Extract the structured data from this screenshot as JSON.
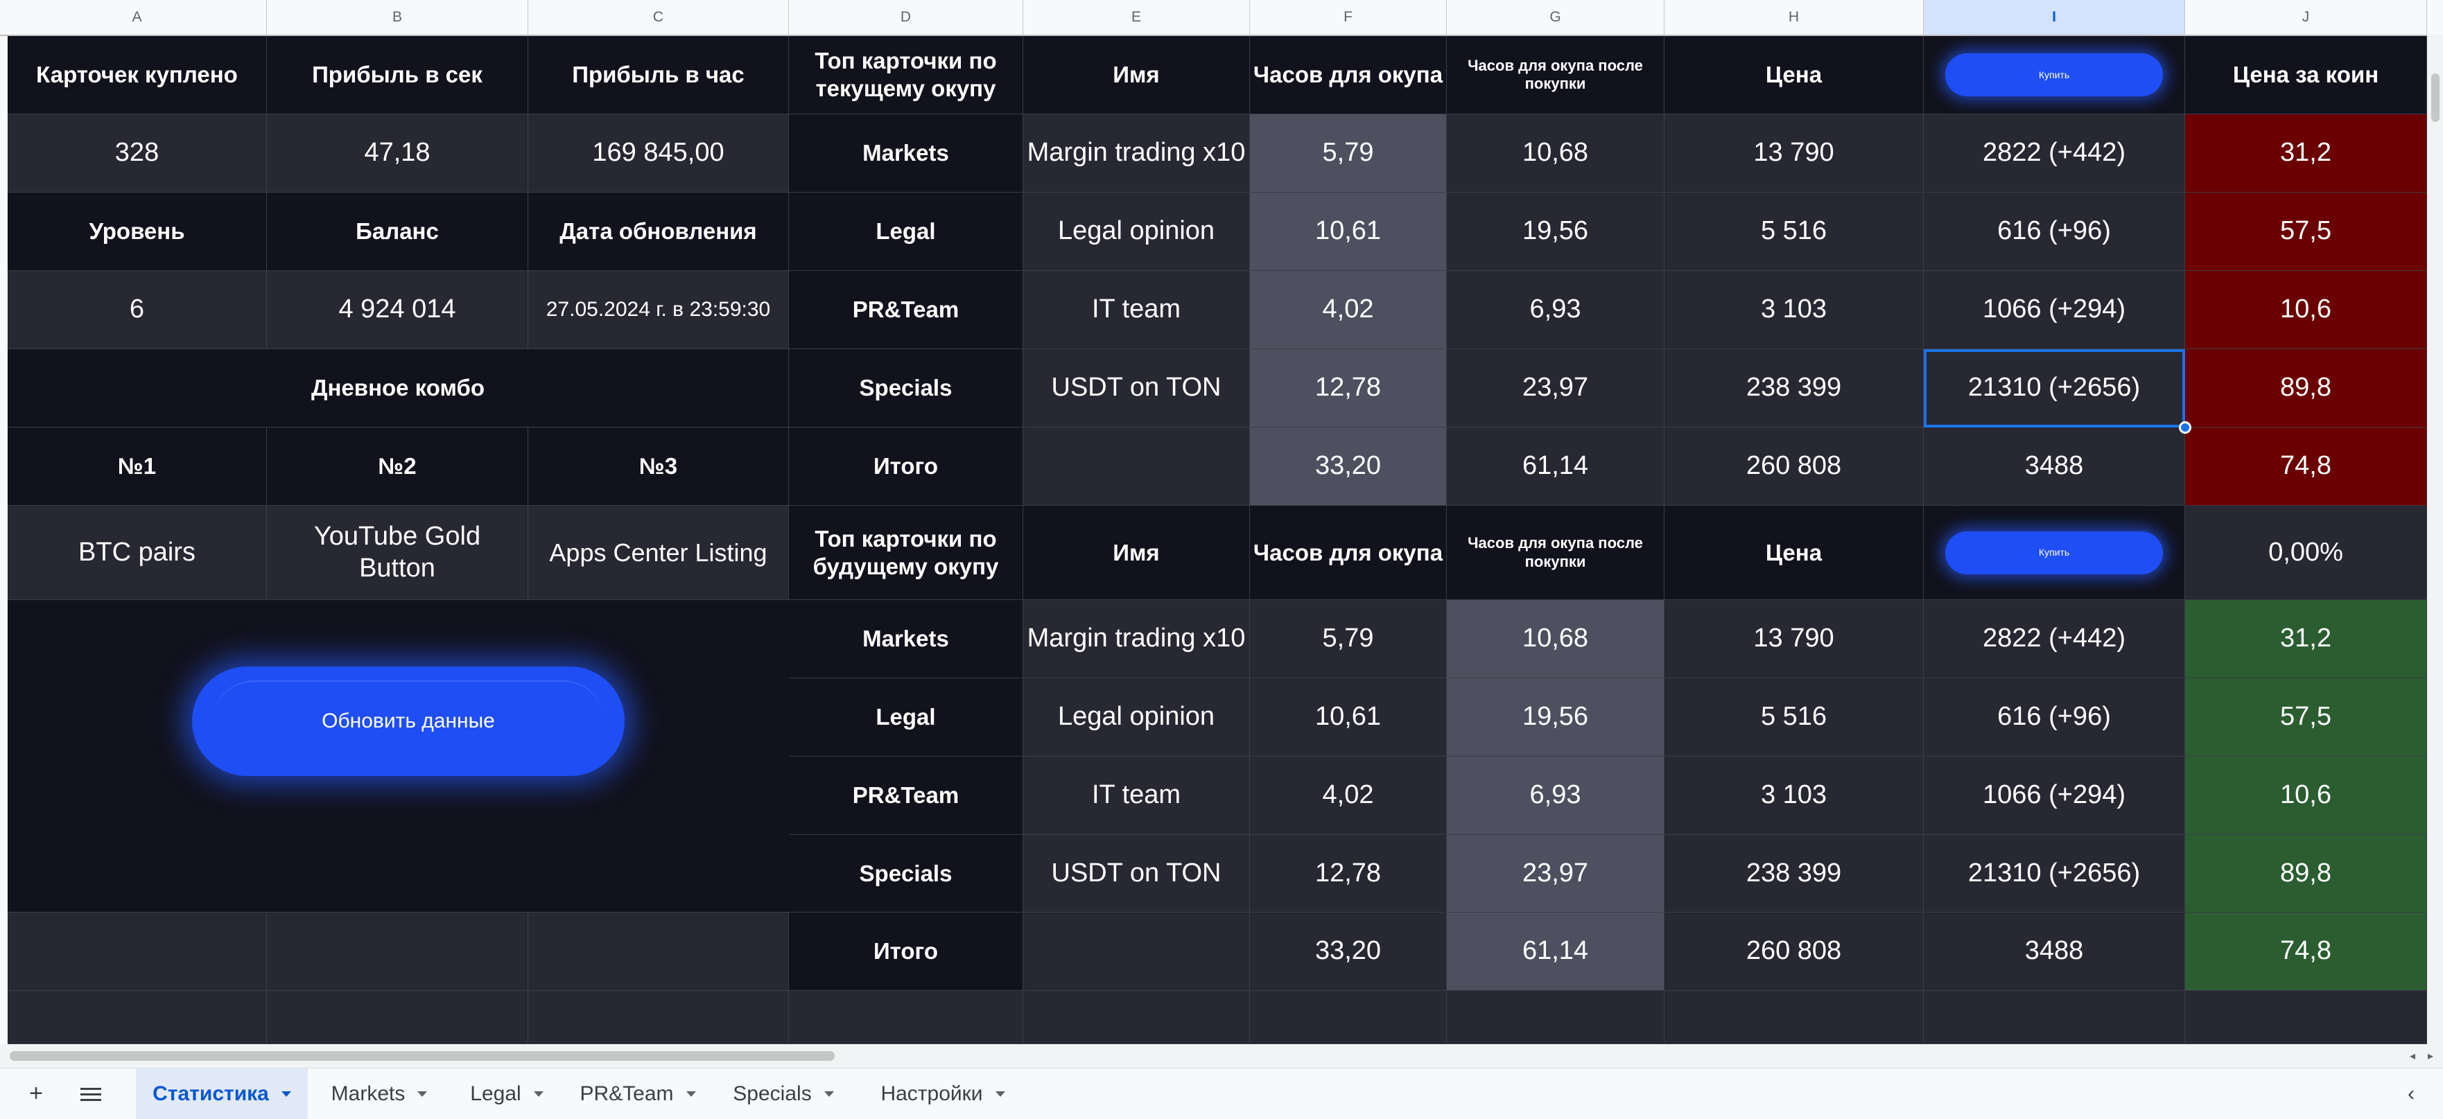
{
  "columns": [
    "A",
    "B",
    "C",
    "D",
    "E",
    "F",
    "G",
    "H",
    "I",
    "J"
  ],
  "stats": {
    "cards_bought_label": "Карточек куплено",
    "profit_sec_label": "Прибыль в сек",
    "profit_hour_label": "Прибыль в час",
    "cards_bought": "328",
    "profit_sec": "47,18",
    "profit_hour": "169 845,00",
    "level_label": "Уровень",
    "balance_label": "Баланс",
    "updated_label": "Дата обновления",
    "level": "6",
    "balance": "4 924 014",
    "updated": "27.05.2024 г. в 23:59:30",
    "combo_title": "Дневное комбо",
    "combo_headers": [
      "№1",
      "№2",
      "№3"
    ],
    "combo_values": [
      "BTC pairs",
      "YouTube Gold Button",
      "Apps Center Listing"
    ],
    "refresh_button": "Обновить данные"
  },
  "current": {
    "headers": {
      "top": "Топ карточки по текущему окупу",
      "name": "Имя",
      "hours": "Часов для окупа",
      "hours_after": "Часов для окупа после покупки",
      "price": "Цена",
      "buy": "Купить",
      "coin_price": "Цена за коин"
    },
    "rows": [
      {
        "cat": "Markets",
        "name": "Margin trading x10",
        "hours": "5,79",
        "hours_after": "10,68",
        "price": "13 790",
        "buy": "2822  (+442)",
        "coin": "31,2"
      },
      {
        "cat": "Legal",
        "name": "Legal opinion",
        "hours": "10,61",
        "hours_after": "19,56",
        "price": "5 516",
        "buy": "616  (+96)",
        "coin": "57,5"
      },
      {
        "cat": "PR&Team",
        "name": "IT team",
        "hours": "4,02",
        "hours_after": "6,93",
        "price": "3 103",
        "buy": "1066  (+294)",
        "coin": "10,6"
      },
      {
        "cat": "Specials",
        "name": "USDT on TON",
        "hours": "12,78",
        "hours_after": "23,97",
        "price": "238 399",
        "buy": "21310  (+2656)",
        "coin": "89,8"
      }
    ],
    "total": {
      "label": "Итого",
      "hours": "33,20",
      "hours_after": "61,14",
      "price": "260 808",
      "buy": "3488",
      "coin": "74,8"
    }
  },
  "future": {
    "headers": {
      "top": "Топ карточки по будущему окупу",
      "name": "Имя",
      "hours": "Часов для окупа",
      "hours_after": "Часов для окупа после покупки",
      "price": "Цена",
      "buy": "Купить",
      "coin_price": "0,00%"
    },
    "rows": [
      {
        "cat": "Markets",
        "name": "Margin trading x10",
        "hours": "5,79",
        "hours_after": "10,68",
        "price": "13 790",
        "buy": "2822  (+442)",
        "coin": "31,2"
      },
      {
        "cat": "Legal",
        "name": "Legal opinion",
        "hours": "10,61",
        "hours_after": "19,56",
        "price": "5 516",
        "buy": "616  (+96)",
        "coin": "57,5"
      },
      {
        "cat": "PR&Team",
        "name": "IT team",
        "hours": "4,02",
        "hours_after": "6,93",
        "price": "3 103",
        "buy": "1066  (+294)",
        "coin": "10,6"
      },
      {
        "cat": "Specials",
        "name": "USDT on TON",
        "hours": "12,78",
        "hours_after": "23,97",
        "price": "238 399",
        "buy": "21310  (+2656)",
        "coin": "89,8"
      }
    ],
    "total": {
      "label": "Итого",
      "hours": "33,20",
      "hours_after": "61,14",
      "price": "260 808",
      "buy": "3488",
      "coin": "74,8"
    }
  },
  "sheet_tabs": [
    "Статистика",
    "Markets",
    "Legal",
    "PR&Team",
    "Specials",
    "Настройки"
  ],
  "active_tab": "Статистика",
  "icons": {
    "add": "plus-icon",
    "menu": "sheets-menu-icon",
    "collapse": "chevron-left-icon"
  },
  "colors": {
    "accent": "#1f4ef5",
    "selection": "#1a73e8",
    "negative": "#6b0000",
    "positive": "#2b5d31"
  }
}
